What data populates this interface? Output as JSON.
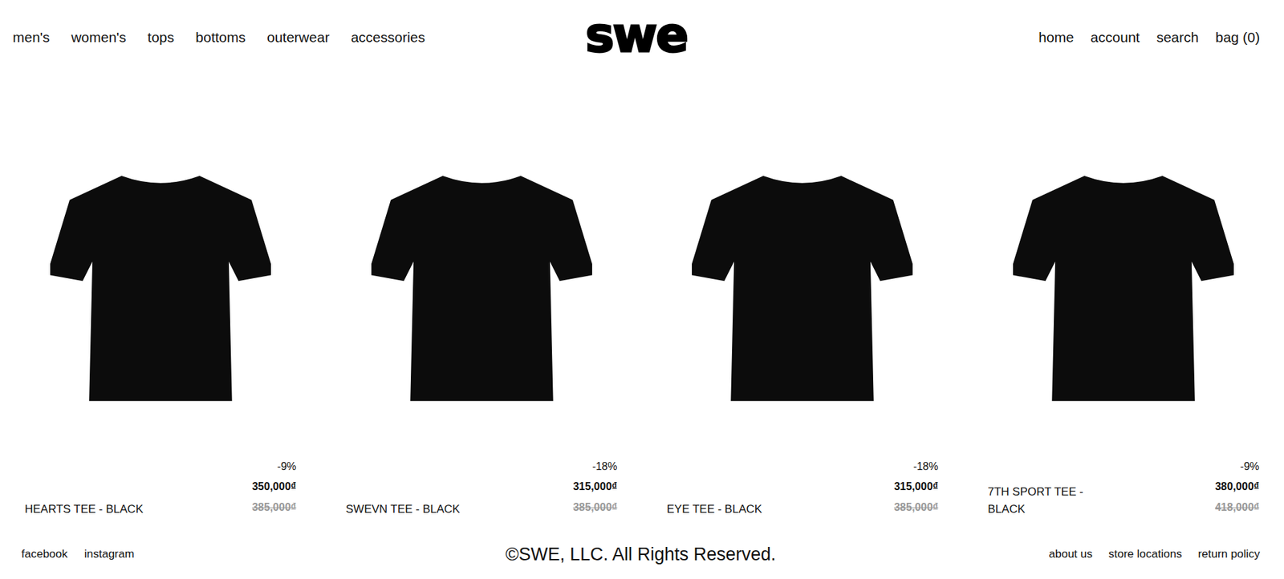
{
  "header": {
    "nav_left": [
      "men's",
      "women's",
      "tops",
      "bottoms",
      "outerwear",
      "accessories"
    ],
    "logo": "swe",
    "nav_right": [
      "home",
      "account",
      "search",
      "bag (0)"
    ]
  },
  "products": [
    {
      "name": "HEARTS TEE - BLACK",
      "discount": "-9%",
      "price": "350,000₫",
      "old_price": "385,000₫"
    },
    {
      "name": "SWEVN TEE - BLACK",
      "discount": "-18%",
      "price": "315,000₫",
      "old_price": "385,000₫"
    },
    {
      "name": "EYE TEE - BLACK",
      "discount": "-18%",
      "price": "315,000₫",
      "old_price": "385,000₫"
    },
    {
      "name": "7TH SPORT TEE - BLACK",
      "discount": "-9%",
      "price": "380,000₫",
      "old_price": "418,000₫"
    }
  ],
  "footer": {
    "social": [
      "facebook",
      "instagram"
    ],
    "copyright": "©SWE, LLC. All Rights Reserved.",
    "links": [
      "about us",
      "store locations",
      "return policy"
    ]
  }
}
